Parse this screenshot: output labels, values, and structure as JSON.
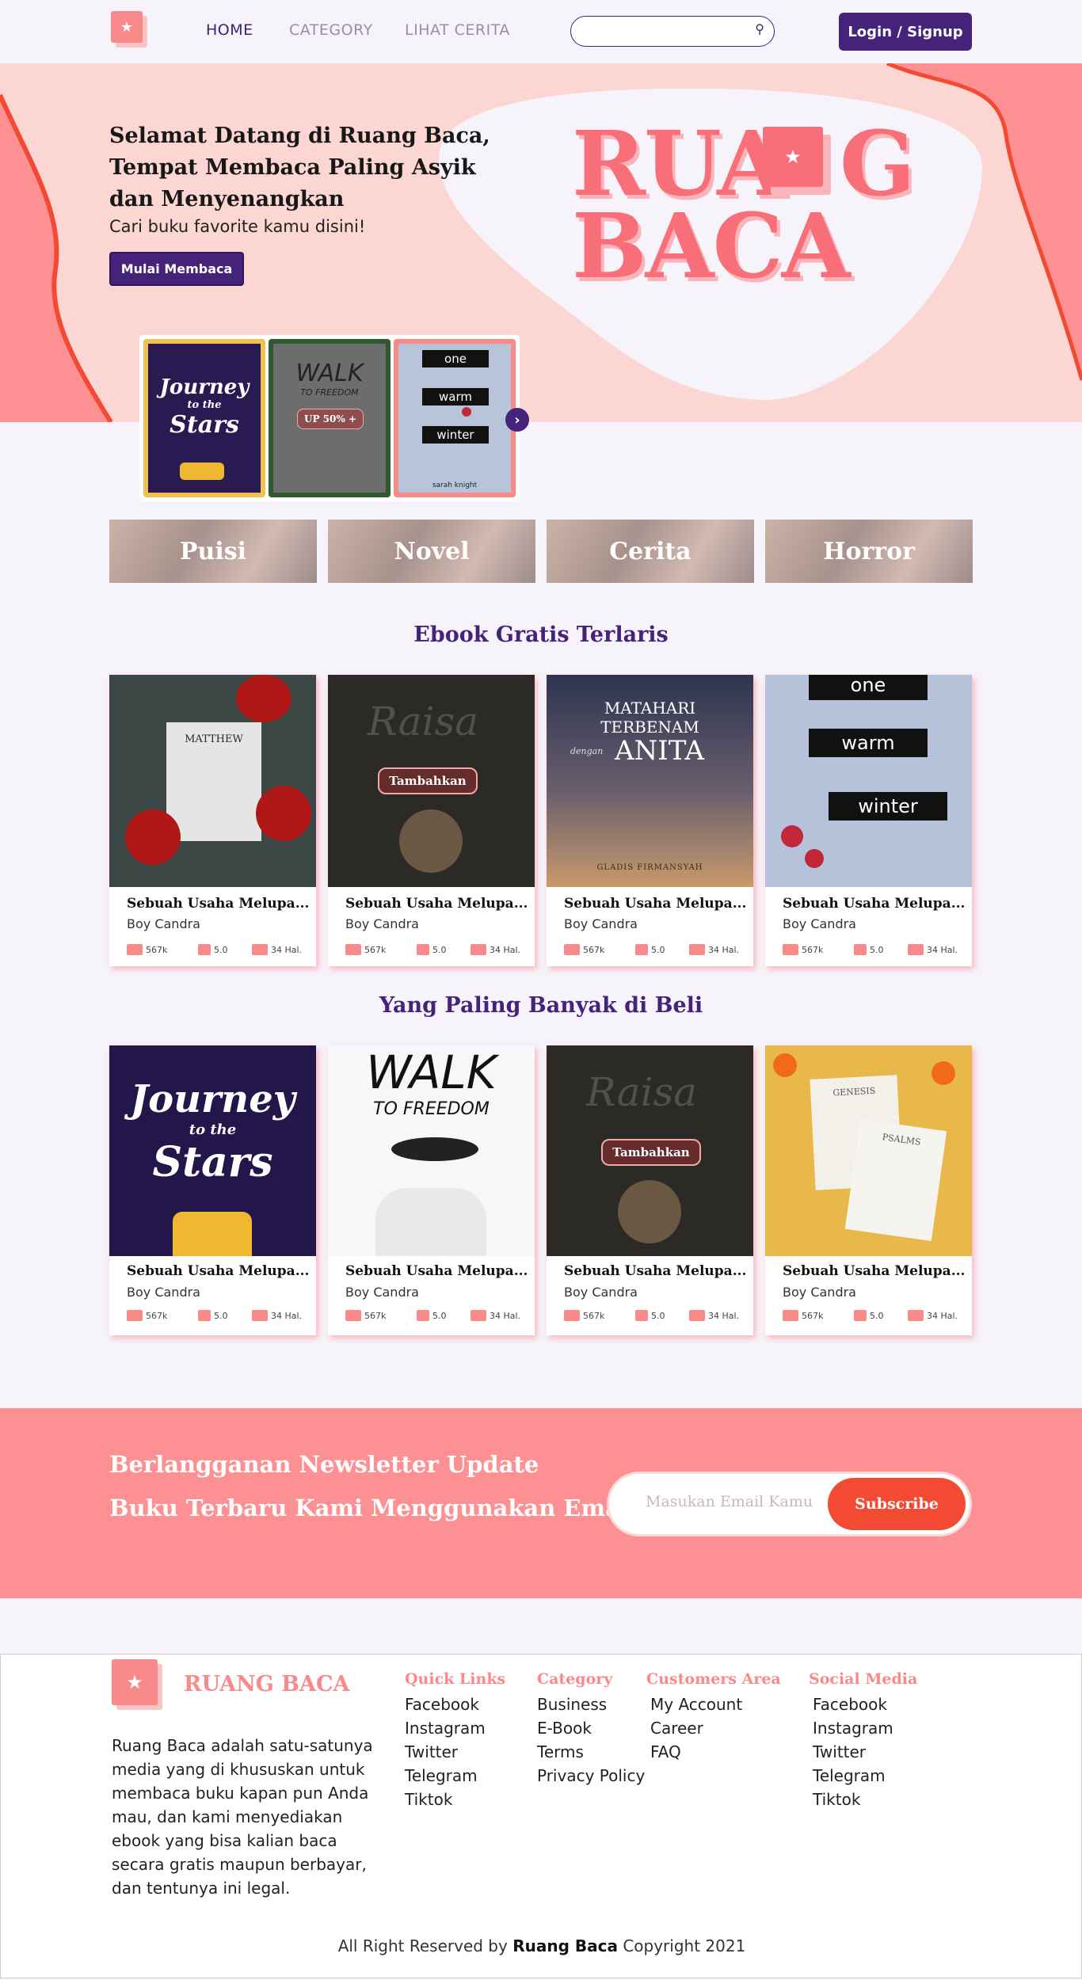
{
  "nav": {
    "logo_icon": "star-icon",
    "links": [
      "HOME",
      "CATEGORY",
      "LIHAT CERITA"
    ],
    "search_placeholder": "",
    "login_label": "Login / Signup"
  },
  "hero": {
    "title_line1": "Selamat Datang di Ruang Baca,",
    "title_line2": "Tempat Membaca Paling Asyik",
    "title_line3": "dan Menyenangkan",
    "subtitle": "Cari buku favorite kamu disini!",
    "cta": "Mulai Membaca",
    "brand_line1_a": "RUA",
    "brand_line1_b": "G",
    "brand_line2": "BACA"
  },
  "carousel": {
    "covers": [
      {
        "title_a": "Journey",
        "title_b": "to the",
        "title_c": "Stars"
      },
      {
        "title_a": "WALK",
        "title_b": "TO FREEDOM",
        "badge": "UP 50% +"
      },
      {
        "words": [
          "one",
          "warm",
          "winter"
        ],
        "author": "sarah knight"
      }
    ]
  },
  "categories": [
    "Puisi",
    "Novel",
    "Cerita",
    "Horror"
  ],
  "section1": {
    "title": "Ebook Gratis Terlaris",
    "books": [
      {
        "title": "Sebuah Usaha Melupa...",
        "author": "Boy Candra",
        "views": "567k",
        "rating": "5.0",
        "pages": "34 Hal.",
        "cover_text": "MATTHEW"
      },
      {
        "title": "Sebuah Usaha Melupa...",
        "author": "Boy Candra",
        "views": "567k",
        "rating": "5.0",
        "pages": "34 Hal.",
        "cover_text": "Raisa",
        "button": "Tambahkan"
      },
      {
        "title": "Sebuah Usaha Melupa...",
        "author": "Boy Candra",
        "views": "567k",
        "rating": "5.0",
        "pages": "34 Hal.",
        "cover_l1": "MATAHARI",
        "cover_l2": "TERBENAM",
        "cover_l3": "dengan",
        "cover_l4": "ANITA",
        "cover_author": "GLADIS FIRMANSYAH"
      },
      {
        "title": "Sebuah Usaha Melupa...",
        "author": "Boy Candra",
        "views": "567k",
        "rating": "5.0",
        "pages": "34 Hal.",
        "words": [
          "one",
          "warm",
          "winter"
        ]
      }
    ]
  },
  "section2": {
    "title": "Yang Paling Banyak di Beli",
    "books": [
      {
        "title": "Sebuah Usaha Melupa...",
        "author": "Boy Candra",
        "views": "567k",
        "rating": "5.0",
        "pages": "34 Hal.",
        "c1": "Journey",
        "c2": "to the",
        "c3": "Stars"
      },
      {
        "title": "Sebuah Usaha Melupa...",
        "author": "Boy Candra",
        "views": "567k",
        "rating": "5.0",
        "pages": "34 Hal.",
        "c1": "WALK",
        "c2": "TO FREEDOM"
      },
      {
        "title": "Sebuah Usaha Melupa...",
        "author": "Boy Candra",
        "views": "567k",
        "rating": "5.0",
        "pages": "34 Hal.",
        "c1": "Raisa",
        "button": "Tambahkan"
      },
      {
        "title": "Sebuah Usaha Melupa...",
        "author": "Boy Candra",
        "views": "567k",
        "rating": "5.0",
        "pages": "34 Hal.",
        "c1": "GENESIS",
        "c2": "PSALMS"
      }
    ]
  },
  "newsletter": {
    "line1": "Berlangganan Newsletter Update",
    "line2": "Buku Terbaru Kami Menggunakan Email",
    "placeholder": "Masukan Email Kamu",
    "button": "Subscribe"
  },
  "footer": {
    "brand": "RUANG BACA",
    "description": [
      "Ruang Baca adalah satu-satunya",
      "media yang di khususkan untuk",
      "membaca buku kapan pun Anda",
      "mau, dan kami menyediakan",
      "ebook yang bisa kalian baca",
      "secara gratis maupun berbayar,",
      "dan tentunya ini legal."
    ],
    "quick_links": {
      "title": "Quick Links",
      "items": [
        "Facebook",
        "Instagram",
        "Twitter",
        "Telegram",
        "Tiktok"
      ]
    },
    "category": {
      "title": "Category",
      "items": [
        "Business",
        "E-Book",
        "Terms",
        "Privacy Policy"
      ]
    },
    "customers": {
      "title": "Customers Area",
      "items": [
        "My Account",
        "Career",
        "FAQ"
      ]
    },
    "social": {
      "title": "Social Media",
      "items": [
        "Facebook",
        "Instagram",
        "Twitter",
        "Telegram",
        "Tiktok"
      ]
    },
    "copyright_a": "All Right Reserved by",
    "copyright_b": "Ruang Baca",
    "copyright_c": "Copyright 2021"
  },
  "colors": {
    "primary": "#46237a",
    "accent": "#f88a8a",
    "hero_bg": "#fcd6d2",
    "subscribe": "#f24a33"
  }
}
